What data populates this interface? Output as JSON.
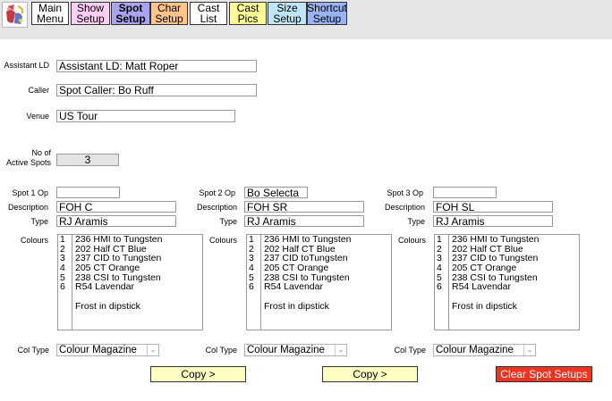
{
  "nav": {
    "tabs": [
      {
        "line1": "Main",
        "line2": "Menu",
        "color": "#ffffff"
      },
      {
        "line1": "Show",
        "line2": "Setup",
        "color": "#ffcef5"
      },
      {
        "line1": "Spot",
        "line2": "Setup",
        "color": "#a9a4f0"
      },
      {
        "line1": "Char",
        "line2": "Setup",
        "color": "#ffc58a"
      },
      {
        "line1": "Cast",
        "line2": "List",
        "color": "#ffffff"
      },
      {
        "line1": "Cast",
        "line2": "Pics",
        "color": "#fcf996"
      },
      {
        "line1": "Size",
        "line2": "Setup",
        "color": "#bfe6f7"
      },
      {
        "line1": "Shortcut",
        "line2": "Setup",
        "color": "#9bb3f2"
      }
    ]
  },
  "form": {
    "assistant_ld_label": "Assistant LD",
    "assistant_ld_value": "Assistant LD: Matt Roper",
    "caller_label": "Caller",
    "caller_value": "Spot Caller: Bo Ruff",
    "venue_label": "Venue",
    "venue_value": "US Tour",
    "active_spots_label_1": "No of",
    "active_spots_label_2": "Active Spots",
    "active_spots_value": "3"
  },
  "spots": [
    {
      "op_label": "Spot  1 Op",
      "op_value": "",
      "description_label": "Description",
      "description_value": "FOH C",
      "type_label": "Type",
      "type_value": "RJ Aramis",
      "colours_label": "Colours",
      "numbers": [
        "1",
        "2",
        "3",
        "4",
        "5",
        "6"
      ],
      "colours": [
        "236 HMI to Tungsten",
        "202 Half CT Blue",
        "237 CID to Tungsten",
        "205 CT Orange",
        "238 CSI to Tungsten",
        "R54 Lavendar",
        "",
        "Frost in dipstick"
      ],
      "col_type_label": "Col Type",
      "col_type_value": "Colour Magazine"
    },
    {
      "op_label": "Spot  2 Op",
      "op_value": "Bo Selecta",
      "description_label": "Description",
      "description_value": "FOH SR",
      "type_label": "Type",
      "type_value": "RJ Aramis",
      "colours_label": "Colours",
      "numbers": [
        "1",
        "2",
        "3",
        "4",
        "5",
        "6"
      ],
      "colours": [
        "236 HMI to Tungsten",
        "202 Half CT Blue",
        "237 CID toTungsten",
        "205 CT Orange",
        "238 CSI to Tungsten",
        "R54 Lavendar",
        "",
        "Frost in dipstick"
      ],
      "col_type_label": "Col Type",
      "col_type_value": "Colour Magazine"
    },
    {
      "op_label": "Spot  3 Op",
      "op_value": "",
      "description_label": "Description",
      "description_value": "FOH SL",
      "type_label": "Type",
      "type_value": "RJ Aramis",
      "colours_label": "Colours",
      "numbers": [
        "1",
        "2",
        "3",
        "4",
        "5",
        "6"
      ],
      "colours": [
        "236 HMI to Tungsten",
        "202 Half CT Blue",
        "237 CID to Tungsten",
        "205 CT Orange",
        "238 CSI to Tungsten",
        "R54 Lavendar",
        "",
        "Frost in dipstick"
      ],
      "col_type_label": "Col Type",
      "col_type_value": "Colour Magazine"
    }
  ],
  "buttons": {
    "copy_1": "Copy >",
    "copy_2": "Copy >",
    "clear": "Clear Spot Setups"
  },
  "colors": {
    "copy_button": "#ffffc4",
    "clear_button": "#ee3322",
    "topbar": "#e6e6e6"
  }
}
